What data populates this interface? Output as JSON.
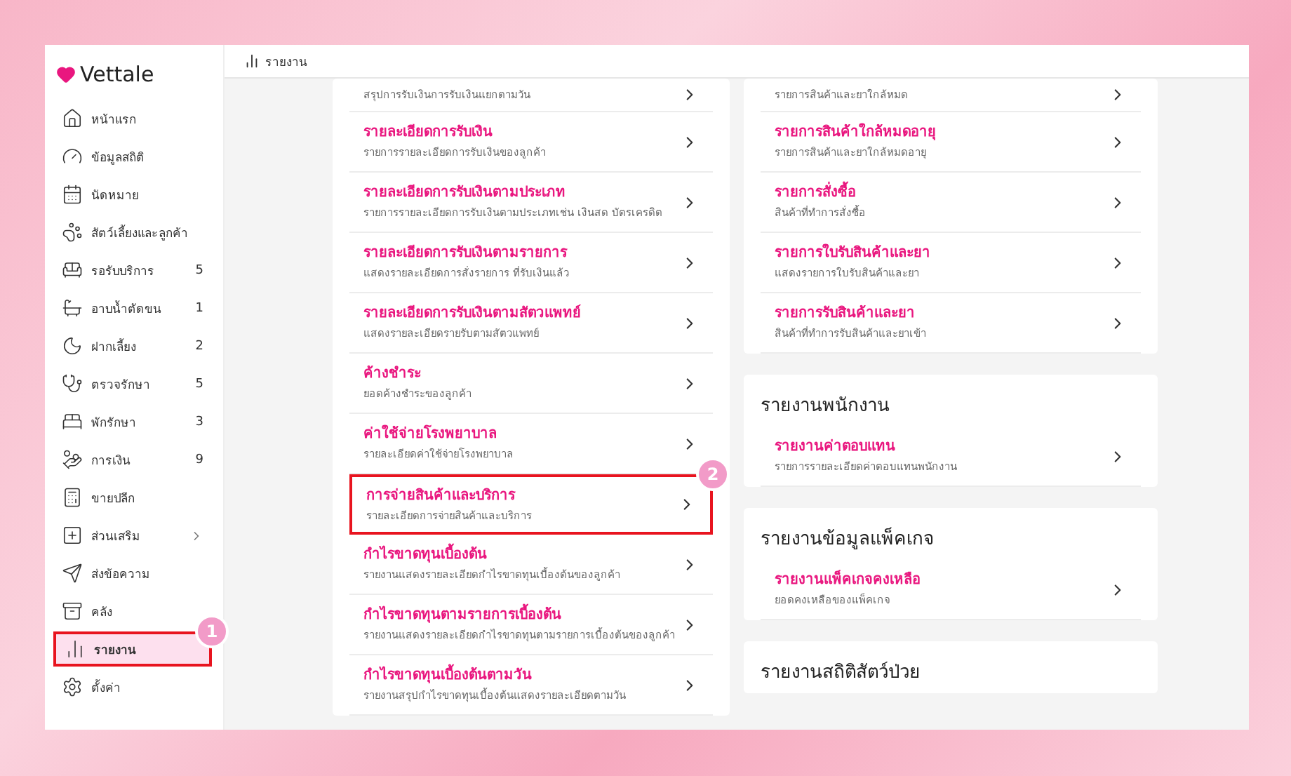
{
  "brand": "Vettale",
  "breadcrumb": "รายงาน",
  "sidebar": {
    "items": [
      {
        "label": "หน้าแรก",
        "selected": false,
        "submenu": false
      },
      {
        "label": "ข้อมูลสถิติ",
        "selected": false,
        "submenu": false
      },
      {
        "label": "นัดหมาย",
        "selected": false,
        "submenu": false
      },
      {
        "label": "สัตว์เลี้ยงและลูกค้า",
        "selected": false,
        "submenu": false
      },
      {
        "label": "รอรับบริการ",
        "count": "5",
        "selected": false,
        "submenu": false
      },
      {
        "label": "อาบน้ำตัดขน",
        "count": "1",
        "selected": false,
        "submenu": false
      },
      {
        "label": "ฝากเลี้ยง",
        "count": "2",
        "selected": false,
        "submenu": false
      },
      {
        "label": "ตรวจรักษา",
        "count": "5",
        "selected": false,
        "submenu": false
      },
      {
        "label": "พักรักษา",
        "count": "3",
        "selected": false,
        "submenu": false
      },
      {
        "label": "การเงิน",
        "count": "9",
        "selected": false,
        "submenu": false
      },
      {
        "label": "ขายปลีก",
        "selected": false,
        "submenu": false
      },
      {
        "label": "ส่วนเสริม",
        "selected": false,
        "submenu": true
      },
      {
        "label": "ส่งข้อความ",
        "selected": false,
        "submenu": false
      },
      {
        "label": "คลัง",
        "selected": false,
        "submenu": false
      },
      {
        "label": "รายงาน",
        "selected": true,
        "submenu": false,
        "callout": "1"
      },
      {
        "label": "ตั้งค่า",
        "selected": false,
        "submenu": false
      }
    ]
  },
  "left_column": [
    {
      "items": [
        {
          "description": "สรุปการรับเงินการรับเงินแยกตามวัน"
        },
        {
          "title": "รายละเอียดการรับเงิน",
          "description": "รายการรายละเอียดการรับเงินของลูกค้า"
        },
        {
          "title": "รายละเอียดการรับเงินตามประเภท",
          "description": "รายการรายละเอียดการรับเงินตามประเภทเช่น เงินสด บัตรเครดิต"
        },
        {
          "title": "รายละเอียดการรับเงินตามรายการ",
          "description": "แสดงรายละเอียดการสั่งรายการ ที่รับเงินแล้ว"
        },
        {
          "title": "รายละเอียดการรับเงินตามสัตวแพทย์",
          "description": "แสดงรายละเอียดรายรับตามสัตวแพทย์"
        },
        {
          "title": "ค้างชำระ",
          "description": "ยอดค้างชำระของลูกค้า"
        },
        {
          "title": "ค่าใช้จ่ายโรงพยาบาล",
          "description": "รายละเอียดค่าใช้จ่ายโรงพยาบาล"
        },
        {
          "title": "การจ่ายสินค้าและบริการ",
          "description": "รายละเอียดการจ่ายสินค้าและบริการ",
          "callout": "2"
        },
        {
          "title": "กำไรขาดทุนเบื้องต้น",
          "description": "รายงานแสดงรายละเอียดกำไรขาดทุนเบื้องต้นของลูกค้า"
        },
        {
          "title": "กำไรขาดทุนตามรายการเบื้องต้น",
          "description": "รายงานแสดงรายละเอียดกำไรขาดทุนตามรายการเบื้องต้นของลูกค้า"
        },
        {
          "title": "กำไรขาดทุนเบื้องต้นตามวัน",
          "description": "รายงานสรุปกำไรขาดทุนเบื้องต้นแสดงรายละเอียดตามวัน"
        }
      ]
    }
  ],
  "right_column": [
    {
      "items": [
        {
          "description": "รายการสินค้าและยาใกล้หมด"
        },
        {
          "title": "รายการสินค้าใกล้หมดอายุ",
          "description": "รายการสินค้าและยาใกล้หมดอายุ"
        },
        {
          "title": "รายการสั่งซื้อ",
          "description": "สินค้าที่ทำการสั่งซื้อ"
        },
        {
          "title": "รายการใบรับสินค้าและยา",
          "description": "แสดงรายการใบรับสินค้าและยา"
        },
        {
          "title": "รายการรับสินค้าและยา",
          "description": "สินค้าที่ทำการรับสินค้าและยาเข้า"
        }
      ]
    },
    {
      "heading": "รายงานพนักงาน",
      "items": [
        {
          "title": "รายงานค่าตอบแทน",
          "description": "รายการรายละเอียดค่าตอบแทนพนักงาน"
        }
      ]
    },
    {
      "heading": "รายงานข้อมูลแพ็คเกจ",
      "items": [
        {
          "title": "รายงานแพ็คเกจคงเหลือ",
          "description": "ยอดคงเหลือของแพ็คเกจ"
        }
      ]
    },
    {
      "heading": "รายงานสถิติสัตว์ป่วย"
    }
  ]
}
